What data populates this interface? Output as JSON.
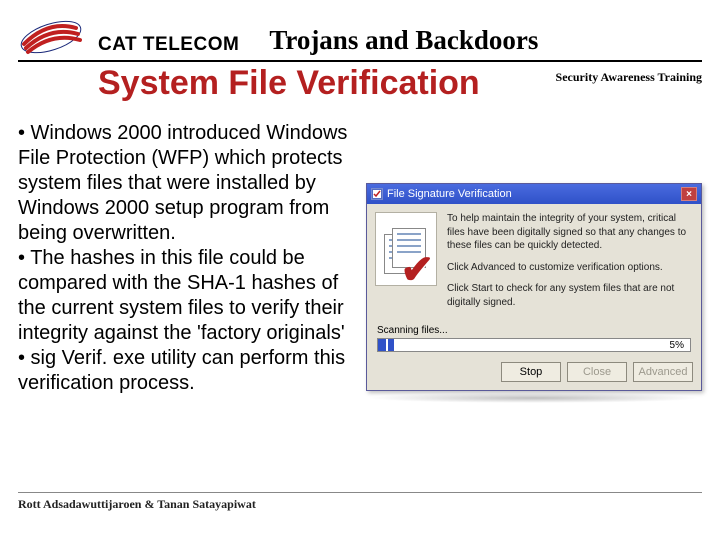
{
  "header": {
    "brand": "CAT TELECOM",
    "topic": "Trojans and Backdoors",
    "corner_note": "Security Awareness Training"
  },
  "title": "System File Verification",
  "bullets": {
    "b1": "• Windows 2000 introduced Windows File Protection (WFP) which protects system files that were installed by Windows 2000 setup  program from being overwritten.",
    "b2": "• The hashes in this file could be compared with the SHA-1 hashes of the current system files to verify their integrity against the 'factory originals'",
    "b3": "• sig Verif. exe utility can perform this verification process."
  },
  "screenshot": {
    "window_title": "File Signature Verification",
    "intro": "To help maintain the integrity of your system, critical files have been digitally signed so that any changes to these files can be quickly detected.",
    "opt1": "Click Advanced to customize verification options.",
    "opt2": "Click Start to check for any system files that are not digitally signed.",
    "scanning_label": "Scanning files...",
    "progress_pct": 5,
    "progress_pct_label": "5%",
    "buttons": {
      "stop": "Stop",
      "close": "Close",
      "advanced": "Advanced"
    }
  },
  "footer": {
    "authors": "Rott Adsadawuttijaroen    &    Tanan Satayapiwat"
  }
}
